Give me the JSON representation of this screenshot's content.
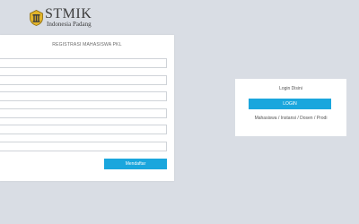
{
  "brand": {
    "title": "STMIK",
    "subtitle": "Indonesia Padang",
    "emblem_icon": "stmik-emblem-icon",
    "accent_color": "#1aa6dd"
  },
  "registration": {
    "title": "REGISTRASI MAHASISWA PKL",
    "fields": [
      {
        "value": "",
        "placeholder": ""
      },
      {
        "value": "",
        "placeholder": ""
      },
      {
        "value": "",
        "placeholder": ""
      },
      {
        "value": "",
        "placeholder": ""
      },
      {
        "value": "",
        "placeholder": ""
      },
      {
        "value": "",
        "placeholder": ""
      }
    ],
    "submit_label": "Mendaftar"
  },
  "login": {
    "title": "Login Disini",
    "button_label": "LOGIN",
    "roles_text": "Mahasiswa / Instansi / Dosen / Prodi"
  }
}
